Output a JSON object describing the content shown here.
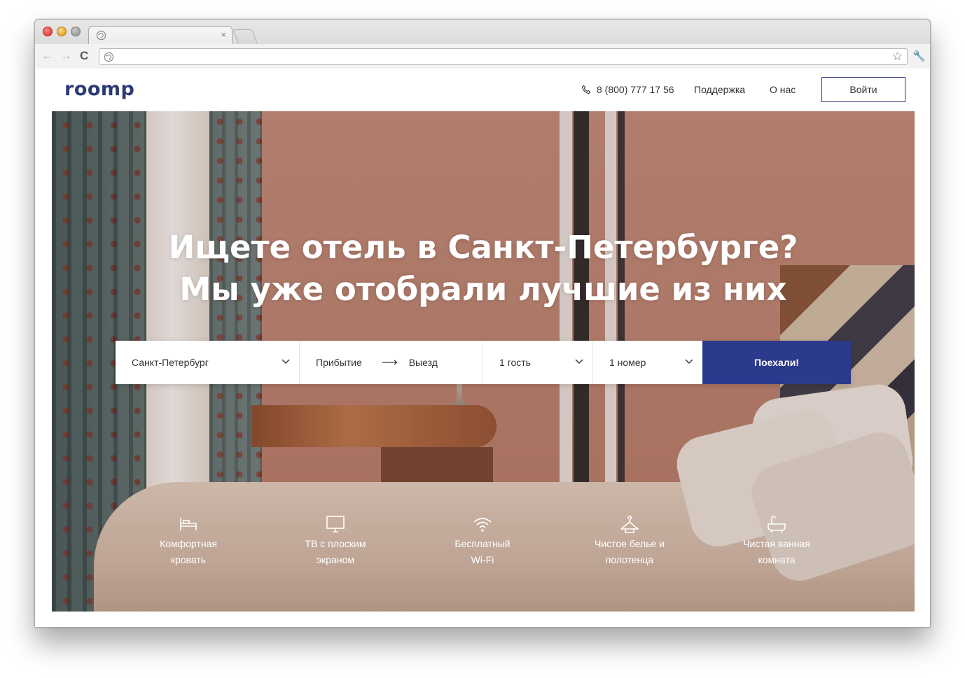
{
  "browser": {
    "tab_close": "×",
    "back": "←",
    "forward": "→",
    "reload": "C",
    "star": "☆",
    "wrench": "🔧"
  },
  "header": {
    "logo": "roomp",
    "phone": "8 (800) 777 17 56",
    "support": "Поддержка",
    "about": "О нас",
    "login": "Войти"
  },
  "hero": {
    "title_line1": "Ищете отель в Санкт-Петербурге?",
    "title_line2": "Мы уже отобрали лучшие из них"
  },
  "search": {
    "city": "Санкт-Петербург",
    "arrival": "Прибытие",
    "arrow": "⟶",
    "departure": "Выезд",
    "guests": "1 гость",
    "rooms": "1 номер",
    "submit": "Поехали!"
  },
  "amenities": [
    {
      "icon": "bed-icon",
      "line1": "Комфортная",
      "line2": "кровать"
    },
    {
      "icon": "tv-icon",
      "line1": "ТВ с плоским",
      "line2": "экраном"
    },
    {
      "icon": "wifi-icon",
      "line1": "Бесплатный",
      "line2": "Wi-Fi"
    },
    {
      "icon": "hanger-icon",
      "line1": "Чистое белье и",
      "line2": "полотенца"
    },
    {
      "icon": "bathtub-icon",
      "line1": "Чистая ванная",
      "line2": "комната"
    }
  ],
  "colors": {
    "brand": "#2c3a74",
    "button": "#2c3a8c"
  }
}
